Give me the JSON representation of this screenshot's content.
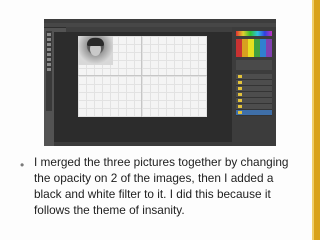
{
  "slide": {
    "bullet_symbol": "•",
    "caption": "I merged the three pictures together by changing the opacity on 2 of the images, then I added a black and white filter to it. I did this because it follows the theme of insanity."
  },
  "colors": {
    "accent_band": "#d9a21b",
    "app_background": "#535353",
    "workspace": "#2c2c2c",
    "layer_selected": "#3f6fa8"
  },
  "embedded_screenshot": {
    "application": "photo-editor",
    "icons": [
      "tool-icons",
      "color-picker",
      "swatches",
      "layers-panel"
    ]
  }
}
